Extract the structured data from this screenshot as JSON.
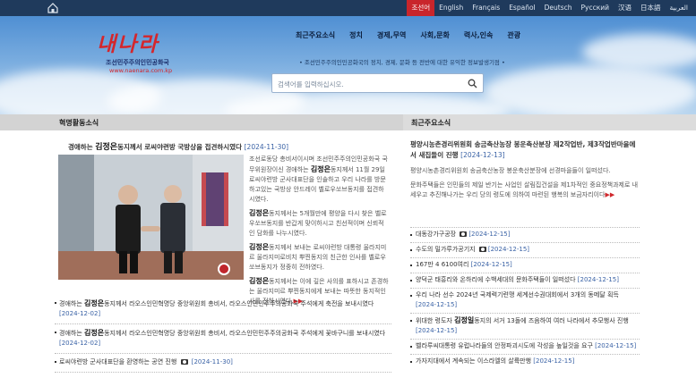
{
  "topbar": {
    "languages": [
      {
        "label": "조선어",
        "active": true
      },
      {
        "label": "English"
      },
      {
        "label": "Français"
      },
      {
        "label": "Español"
      },
      {
        "label": "Deutsch"
      },
      {
        "label": "Русский"
      },
      {
        "label": "汉语"
      },
      {
        "label": "日本語"
      },
      {
        "label": "العربية"
      }
    ]
  },
  "header": {
    "logo_text": "내나라",
    "logo_subtitle": "조선민주주의인민공화국",
    "logo_url": "www.naenara.com.kp",
    "nav": [
      "최근주요소식",
      "정치",
      "경제,무역",
      "사회,문화",
      "력사,인속",
      "관광"
    ],
    "tagline": "• 조선민주주의인민공화국의 정치, 경제, 문화 등 전반에 대한 유익한 정보발생기점 •",
    "search_placeholder": "검색어를 입력하십시오."
  },
  "left": {
    "section_title": "혁명활동소식",
    "lead": {
      "pre": "경애하는 ",
      "name": "김정은",
      "post": "동지께서 로씨야련방 국방상을 접견하시였다",
      "date": "[2024-11-30]"
    },
    "body": [
      {
        "pre": "조선로동당 총비서이시며 조선민주주의인민공화국 국무위원장이신 경애하는 ",
        "name": "김정은",
        "post": "동지께서 11월 29일 로씨야련방 군사대표단을 인솔하고 우리 나라를 방문하고있는 국방상 안드레이 벨로우쏘브동지를 접견하시였다."
      },
      {
        "pre": "",
        "name": "김정은",
        "post": "동지께서는 5개월만에 평양을 다시 찾은 벨로우쏘브동지를 반갑게 맞이하시고 친선적이며 신뢰적인 담화를 나누시였다."
      },
      {
        "pre": "",
        "name": "김정은",
        "post": "동지께서 보내는 로씨야련방 대통령 울라지미르 울라지미로비치 뿌찐동지의 친근한 인사를 벨로우쏘브동지가 정중히 전하였다."
      },
      {
        "pre": "",
        "name": "김정은",
        "post": "동지께서는 이에 깊은 사의를 표하시고 존경하는 울라지미르 뿌찐동지에게 보내는 따뜻한 동지적인사를 전하시였다."
      }
    ],
    "list": [
      {
        "pre": "경애하는 ",
        "name": "김정은",
        "post": "동지께서 라오스인민혁명당 중앙위원회 총비서, 라오스인민민주주의공화국 주석에게 축전을 보내시였다",
        "date": "[2024-12-02]",
        "cam": false
      },
      {
        "pre": "경애하는 ",
        "name": "김정은",
        "post": "동지께서 라오스인민혁명당 중앙위원회 총비서, 라오스인민민주주의공화국 주석에게 꽃바구니를 보내시였다",
        "date": "[2024-12-02]",
        "cam": false
      },
      {
        "pre": "로씨야련방 군사대표단을 환영하는 공연 진행 ",
        "name": "",
        "post": "",
        "date": "[2024-11-30]",
        "cam": true
      }
    ]
  },
  "right": {
    "section_title": "최근주요소식",
    "lead": "평양시농촌경리위원회 송금축산농장 봉운축산분장 제2작업반, 제3작업반마을에서 새집들이 진행",
    "lead_date": "[2024-12-13]",
    "paragraphs": [
      "평양시농촌경리위원회 송금축산농장 봉운축산분장에 선경마을들이 일떠섰다.",
      "문화주택들은 인민들의 제일 반기는 사업인 살림집건설을 제1차적인 중요정책과제로 내세우고 추진해나가는 우리 당의 령도에 의하여 마련된 행복의 보금자리이다"
    ],
    "list": [
      {
        "text": "대동강가구공장 ",
        "name": "",
        "post": "",
        "date": "[2024-12-15]",
        "cam": true
      },
      {
        "text": "수도의 밀가루가공기지 ",
        "name": "",
        "post": "",
        "date": "[2024-12-15]",
        "cam": true
      },
      {
        "text": "167만 4 6100여리 ",
        "name": "",
        "post": "",
        "date": "[2024-12-15]",
        "cam": false
      },
      {
        "text": "양덕군 태흥리와 온하리에 수백세대의 문화주택들이 일떠섰다 ",
        "name": "",
        "post": "",
        "date": "[2024-12-15]",
        "cam": false
      },
      {
        "text": "우리 나라 선수 2024년 국제력기련맹 세계선수권대회에서 3개의 동메달 획득 ",
        "name": "",
        "post": "",
        "date": "[2024-12-15]",
        "cam": false
      },
      {
        "text": "위대한 령도자 ",
        "name": "김정일",
        "post": "동지의 서거 13돌에 즈음하여 여러 나라에서 추모행사 진행 ",
        "date": "[2024-12-15]",
        "cam": false
      },
      {
        "text": "벨라루씨대통령 유럽나라들의 안정파괴시도에 각성을 높일것을 요구 ",
        "name": "",
        "post": "",
        "date": "[2024-12-15]",
        "cam": false
      },
      {
        "text": "가자지대에서 계속되는 이스라엘의 살륙만행 ",
        "name": "",
        "post": "",
        "date": "[2024-12-15]",
        "cam": false
      }
    ]
  },
  "colors": {
    "topbar": "#1f3a5c",
    "accent_red": "#d4262c",
    "date_blue": "#3b63a6"
  }
}
